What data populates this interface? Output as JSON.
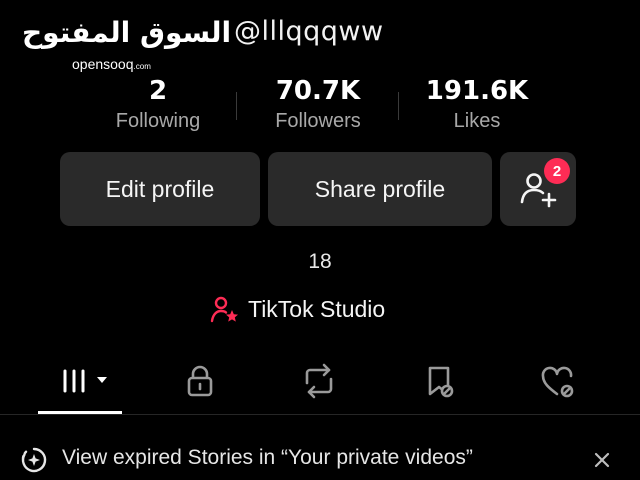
{
  "watermark": {
    "arabic": "السوق المفتوح",
    "latin": "opensooq",
    "suffix": ".com"
  },
  "profile": {
    "username": "@lllqqqww",
    "age": "18"
  },
  "stats": [
    {
      "value": "2",
      "label": "Following"
    },
    {
      "value": "70.7K",
      "label": "Followers"
    },
    {
      "value": "191.6K",
      "label": "Likes"
    }
  ],
  "buttons": {
    "edit_profile": "Edit profile",
    "share_profile": "Share profile",
    "add_friends_badge": "2"
  },
  "studio": {
    "label": "TikTok Studio",
    "icon": "person-star-icon"
  },
  "tabs": [
    {
      "icon": "grid-icon",
      "selected": true
    },
    {
      "icon": "lock-icon"
    },
    {
      "icon": "repost-icon"
    },
    {
      "icon": "bookmark-icon"
    },
    {
      "icon": "liked-heart-icon"
    }
  ],
  "banner": {
    "text": "View expired Stories in “Your private videos”",
    "icon": "stories-plus-icon",
    "close_icon": "close-icon"
  },
  "colors": {
    "background": "#000000",
    "button_bg": "#2a2a2a",
    "accent": "#fe2c55",
    "muted_text": "#a8a8a8"
  }
}
